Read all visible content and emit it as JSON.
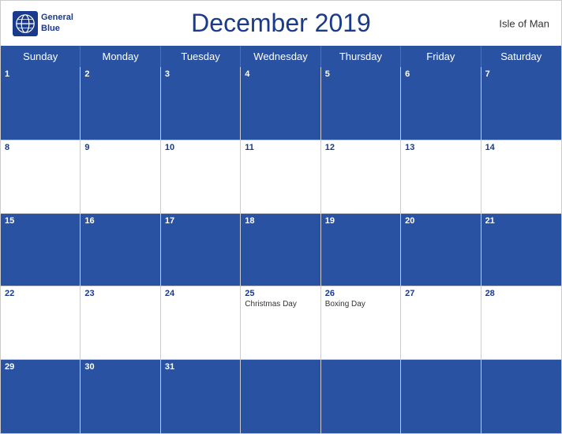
{
  "header": {
    "title": "December 2019",
    "region": "Isle of Man",
    "logo_line1": "General",
    "logo_line2": "Blue"
  },
  "day_headers": [
    "Sunday",
    "Monday",
    "Tuesday",
    "Wednesday",
    "Thursday",
    "Friday",
    "Saturday"
  ],
  "weeks": [
    {
      "style": "blue",
      "days": [
        {
          "num": "1",
          "event": ""
        },
        {
          "num": "2",
          "event": ""
        },
        {
          "num": "3",
          "event": ""
        },
        {
          "num": "4",
          "event": ""
        },
        {
          "num": "5",
          "event": ""
        },
        {
          "num": "6",
          "event": ""
        },
        {
          "num": "7",
          "event": ""
        }
      ]
    },
    {
      "style": "white",
      "days": [
        {
          "num": "8",
          "event": ""
        },
        {
          "num": "9",
          "event": ""
        },
        {
          "num": "10",
          "event": ""
        },
        {
          "num": "11",
          "event": ""
        },
        {
          "num": "12",
          "event": ""
        },
        {
          "num": "13",
          "event": ""
        },
        {
          "num": "14",
          "event": ""
        }
      ]
    },
    {
      "style": "blue",
      "days": [
        {
          "num": "15",
          "event": ""
        },
        {
          "num": "16",
          "event": ""
        },
        {
          "num": "17",
          "event": ""
        },
        {
          "num": "18",
          "event": ""
        },
        {
          "num": "19",
          "event": ""
        },
        {
          "num": "20",
          "event": ""
        },
        {
          "num": "21",
          "event": ""
        }
      ]
    },
    {
      "style": "white",
      "days": [
        {
          "num": "22",
          "event": ""
        },
        {
          "num": "23",
          "event": ""
        },
        {
          "num": "24",
          "event": ""
        },
        {
          "num": "25",
          "event": "Christmas Day"
        },
        {
          "num": "26",
          "event": "Boxing Day"
        },
        {
          "num": "27",
          "event": ""
        },
        {
          "num": "28",
          "event": ""
        }
      ]
    },
    {
      "style": "blue",
      "days": [
        {
          "num": "29",
          "event": ""
        },
        {
          "num": "30",
          "event": ""
        },
        {
          "num": "31",
          "event": ""
        },
        {
          "num": "",
          "event": ""
        },
        {
          "num": "",
          "event": ""
        },
        {
          "num": "",
          "event": ""
        },
        {
          "num": "",
          "event": ""
        }
      ]
    }
  ],
  "accent_color": "#2952a3",
  "title_color": "#1a3a8c"
}
